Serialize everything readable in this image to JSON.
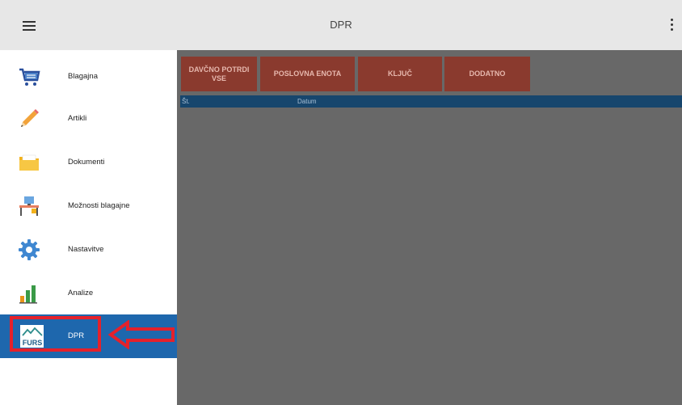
{
  "app_bar": {
    "title": "DPR"
  },
  "nav": {
    "items": [
      {
        "label": "Blagajna",
        "icon": "cart-icon"
      },
      {
        "label": "Artikli",
        "icon": "pencil-icon"
      },
      {
        "label": "Dokumenti",
        "icon": "folder-icon"
      },
      {
        "label": "Možnosti blagajne",
        "icon": "desk-icon"
      },
      {
        "label": "Nastavitve",
        "icon": "gear-icon"
      },
      {
        "label": "Analize",
        "icon": "bar-chart-icon"
      },
      {
        "label": "DPR",
        "icon": "furs-logo-icon",
        "active": true,
        "logo_text": "FURS"
      }
    ]
  },
  "toolbar": {
    "buttons": [
      "DAVČNO POTRDI\nVSE",
      "POSLOVNA ENOTA",
      "KLJUČ",
      "DODATNO"
    ]
  },
  "table": {
    "headers": [
      "Št.",
      "Datum"
    ]
  },
  "colors": {
    "accent": "#1e67ad",
    "button_bg": "#8a3a2e",
    "annotation": "#e4212b",
    "table_header": "#17466d"
  }
}
